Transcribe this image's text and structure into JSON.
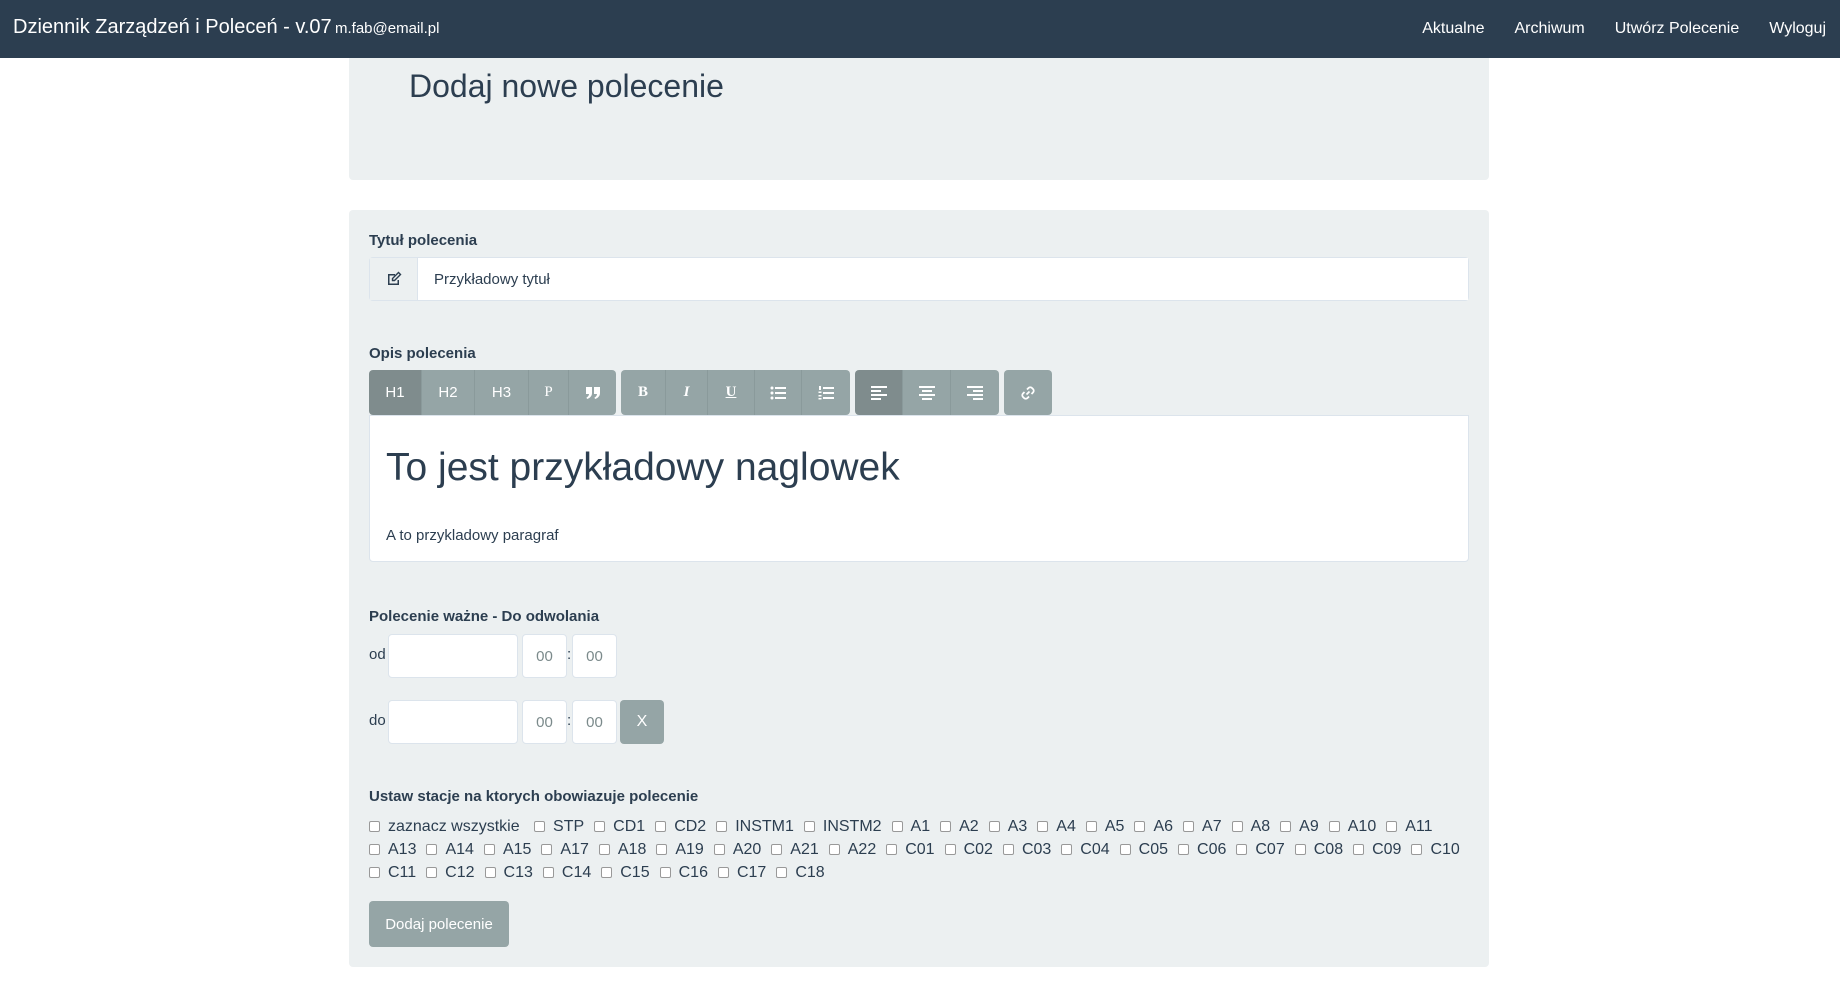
{
  "navbar": {
    "brand": "Dziennik Zarządzeń i Poleceń - v.07",
    "email": "m.fab@email.pl",
    "links": [
      "Aktualne",
      "Archiwum",
      "Utwórz Polecenie",
      "Wyloguj"
    ]
  },
  "jumbotron": {
    "title": "Dodaj nowe polecenie"
  },
  "form": {
    "title_label": "Tytuł polecenia",
    "title_value": "Przykładowy tytuł",
    "desc_label": "Opis polecenia",
    "toolbar": {
      "h1": "H1",
      "h2": "H2",
      "h3": "H3",
      "p": "P",
      "bold": "B",
      "italic": "I",
      "underline": "U"
    },
    "editor": {
      "heading": "To jest przykładowy naglowek",
      "paragraph": "A to przykladowy paragraf"
    },
    "validity_label": "Polecenie ważne - Do odwolania",
    "from_label": "od",
    "to_label": "do",
    "time_value": "00",
    "colon": ":",
    "clear_label": "X",
    "stations_label": "Ustaw stacje na ktorych obowiazuje polecenie",
    "select_all": "zaznacz wszystkie",
    "stations": [
      "STP",
      "CD1",
      "CD2",
      "INSTM1",
      "INSTM2",
      "A1",
      "A2",
      "A3",
      "A4",
      "A5",
      "A6",
      "A7",
      "A8",
      "A9",
      "A10",
      "A11",
      "A13",
      "A14",
      "A15",
      "A17",
      "A18",
      "A19",
      "A20",
      "A21",
      "A22",
      "C01",
      "C02",
      "C03",
      "C04",
      "C05",
      "C06",
      "C07",
      "C08",
      "C09",
      "C10",
      "C11",
      "C12",
      "C13",
      "C14",
      "C15",
      "C16",
      "C17",
      "C18"
    ],
    "submit": "Dodaj polecenie"
  },
  "colors": {
    "navbar": "#2c3e50",
    "panel": "#ecf0f1",
    "button": "#95a5a6"
  }
}
